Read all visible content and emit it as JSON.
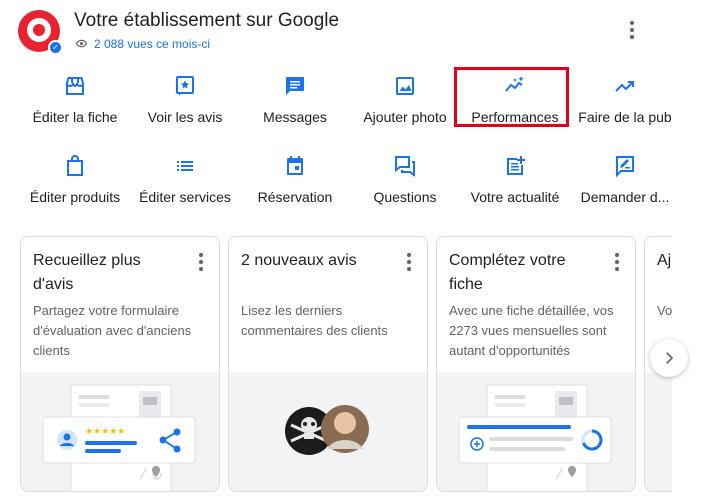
{
  "header": {
    "title": "Votre établissement sur Google",
    "views": "2 088 vues ce mois-ci"
  },
  "actions_row1": [
    {
      "label": "Éditer la fiche",
      "icon": "storefront-icon"
    },
    {
      "label": "Voir les avis",
      "icon": "star-review-icon"
    },
    {
      "label": "Messages",
      "icon": "message-icon"
    },
    {
      "label": "Ajouter photo",
      "icon": "photo-icon"
    },
    {
      "label": "Performances",
      "icon": "sparkle-chart-icon"
    },
    {
      "label": "Faire de la pub",
      "icon": "trending-up-icon"
    }
  ],
  "actions_row2": [
    {
      "label": "Éditer produits",
      "icon": "shopping-bag-icon"
    },
    {
      "label": "Éditer services",
      "icon": "list-icon"
    },
    {
      "label": "Réservation",
      "icon": "calendar-icon"
    },
    {
      "label": "Questions",
      "icon": "forum-icon"
    },
    {
      "label": "Votre actualité",
      "icon": "post-add-icon"
    },
    {
      "label": "Demander d...",
      "icon": "rate-review-icon"
    }
  ],
  "cards": [
    {
      "title": "Recueillez plus d'avis",
      "description": "Partagez votre formulaire d'évaluation avec d'anciens clients"
    },
    {
      "title": "2 nouveaux avis",
      "description": "Lisez les derniers commentaires des clients"
    },
    {
      "title": "Complétez votre fiche",
      "description": "Avec une fiche détaillée, vos 2273 vues mensuelles sont autant d'opportunités"
    },
    {
      "title": "Aj nu",
      "description": "Vo ap"
    }
  ],
  "colors": {
    "accent": "#1a73e8",
    "brand_red": "#e8222e",
    "highlight": "#e3001b"
  }
}
